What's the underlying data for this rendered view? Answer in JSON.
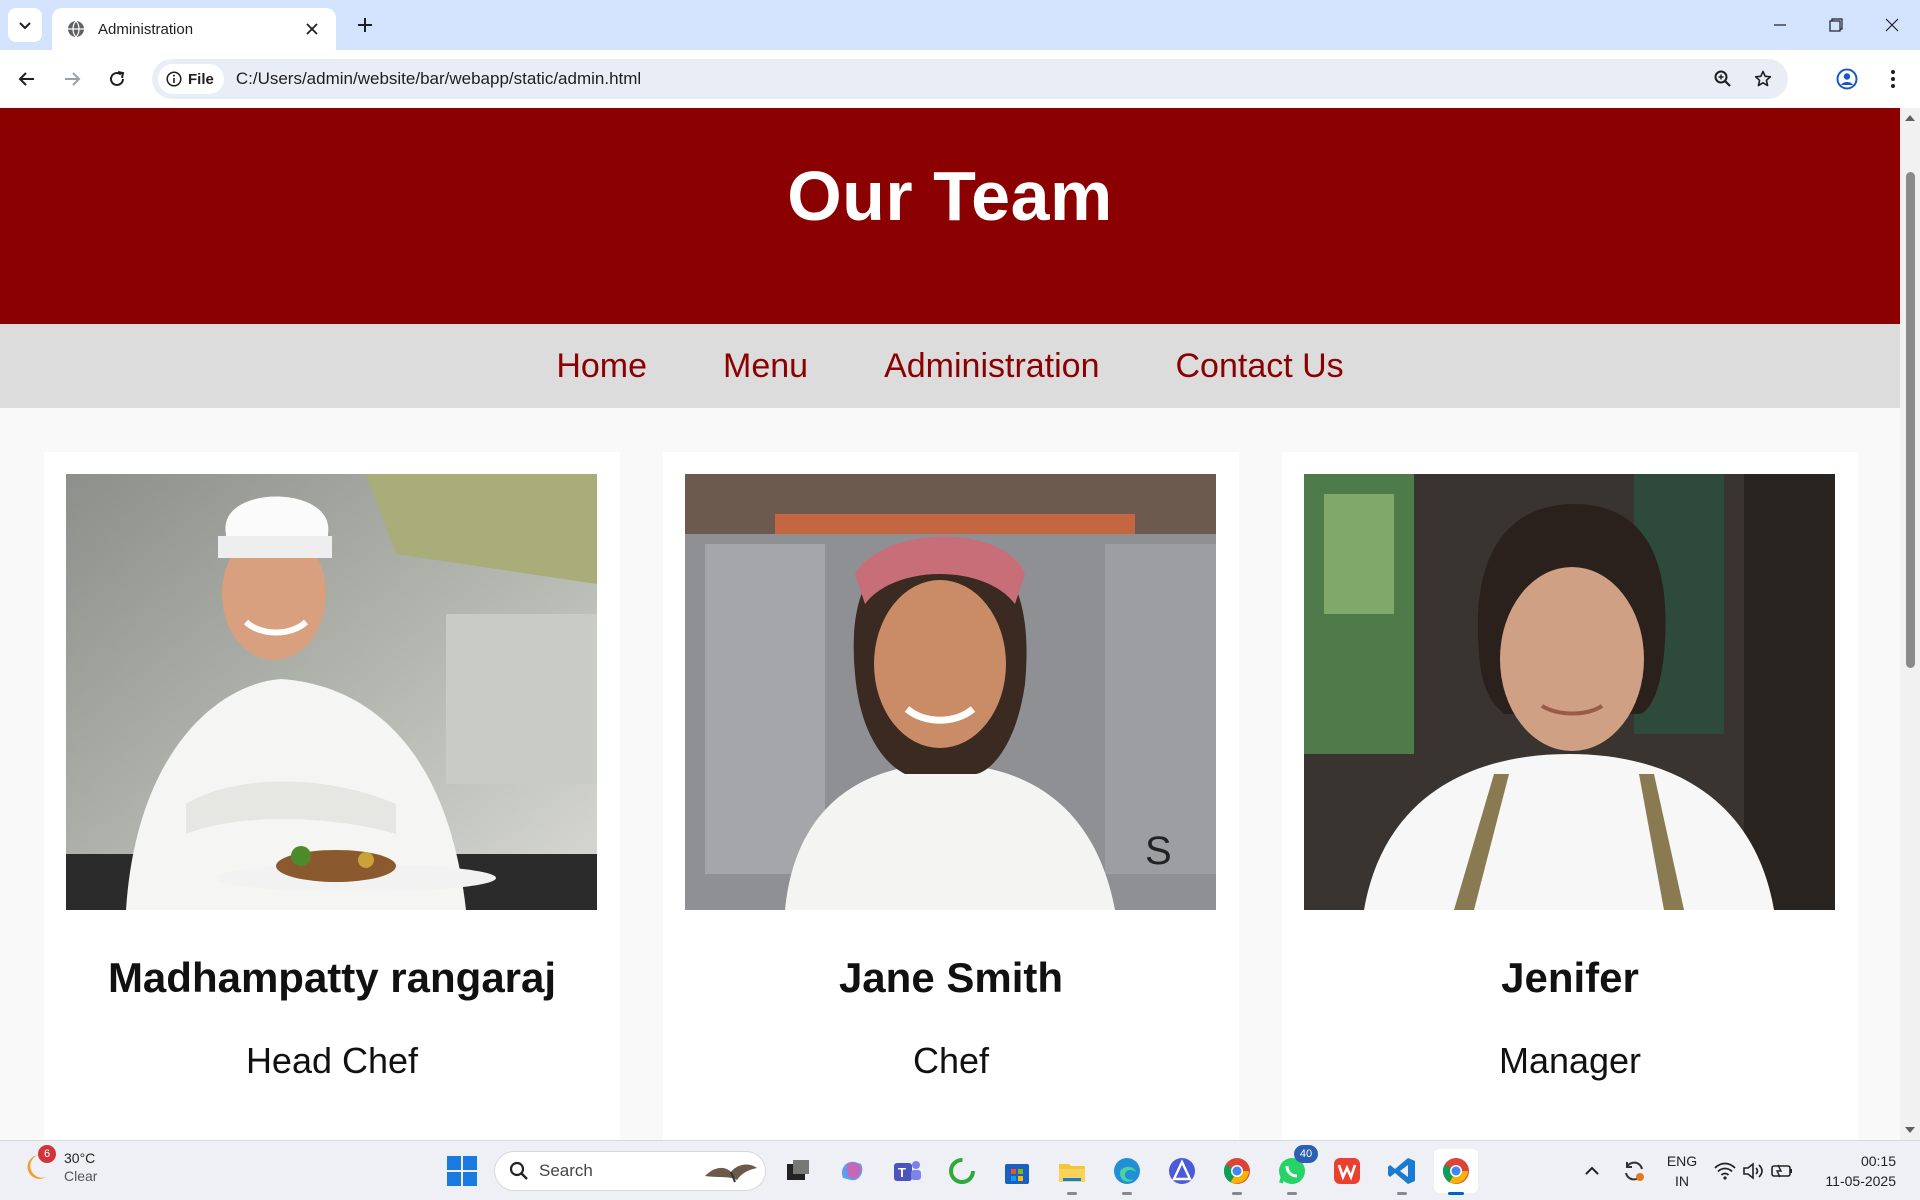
{
  "browser": {
    "tab_title": "Administration",
    "address_chip": "File",
    "url": "C:/Users/admin/website/bar/webapp/static/admin.html"
  },
  "page": {
    "heading": "Our Team",
    "nav": [
      "Home",
      "Menu",
      "Administration",
      "Contact Us"
    ],
    "team": [
      {
        "name": "Madhampatty rangaraj",
        "role": "Head Chef"
      },
      {
        "name": "Jane Smith",
        "role": "Chef"
      },
      {
        "name": "Jenifer",
        "role": "Manager"
      }
    ]
  },
  "colors": {
    "header_bg": "#8b0000",
    "nav_bg": "#dcdcdc",
    "nav_link": "#8b0000",
    "chrome_tabstrip": "#d3e3fd"
  },
  "taskbar": {
    "weather_badge": "6",
    "temperature": "30°C",
    "condition": "Clear",
    "search_placeholder": "Search",
    "whatsapp_badge": "40",
    "lang_line1": "ENG",
    "lang_line2": "IN",
    "time": "00:15",
    "date": "11-05-2025"
  }
}
